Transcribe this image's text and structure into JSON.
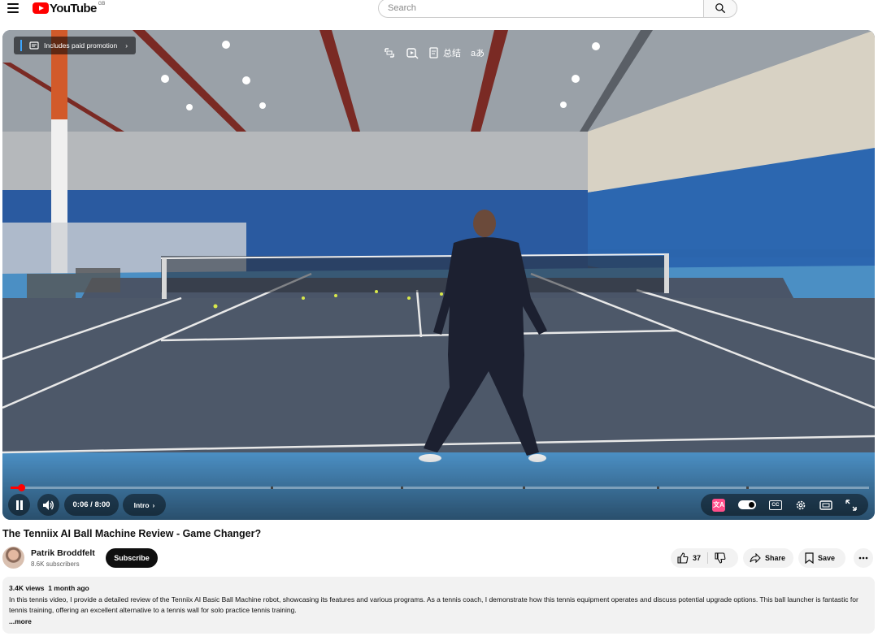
{
  "header": {
    "logo_text": "YouTube",
    "logo_country": "GB",
    "search_placeholder": "Search"
  },
  "player": {
    "promo_label": "Includes paid promotion",
    "overlay_tool_summary": "总结",
    "overlay_tool_translate": "aあ",
    "time": "0:06 / 8:00",
    "chapter": "Intro",
    "ai_badge": "文A",
    "cc_label": "CC",
    "progress_fraction": 0.0125
  },
  "video": {
    "title": "The Tenniix AI Ball Machine Review - Game Changer?"
  },
  "channel": {
    "name": "Patrik Broddfelt",
    "subscribers": "8.6K subscribers",
    "subscribe_label": "Subscribe"
  },
  "actions": {
    "likes": "37",
    "share_label": "Share",
    "save_label": "Save"
  },
  "description": {
    "views": "3.4K views",
    "age": "1 month ago",
    "text": "In this tennis video, I provide a detailed review of the Tenniix AI Basic Ball Machine robot, showcasing its features and various programs. As a tennis coach, I demonstrate how this tennis equipment operates and discuss potential upgrade options. This ball launcher is fantastic for tennis training, offering an excellent alternative to a tennis wall for solo practice tennis training.",
    "more_label": "...more"
  },
  "colors": {
    "brand_red": "#ff0000",
    "court_blue": "#2f6fb3",
    "court_surface": "#4a5566"
  }
}
